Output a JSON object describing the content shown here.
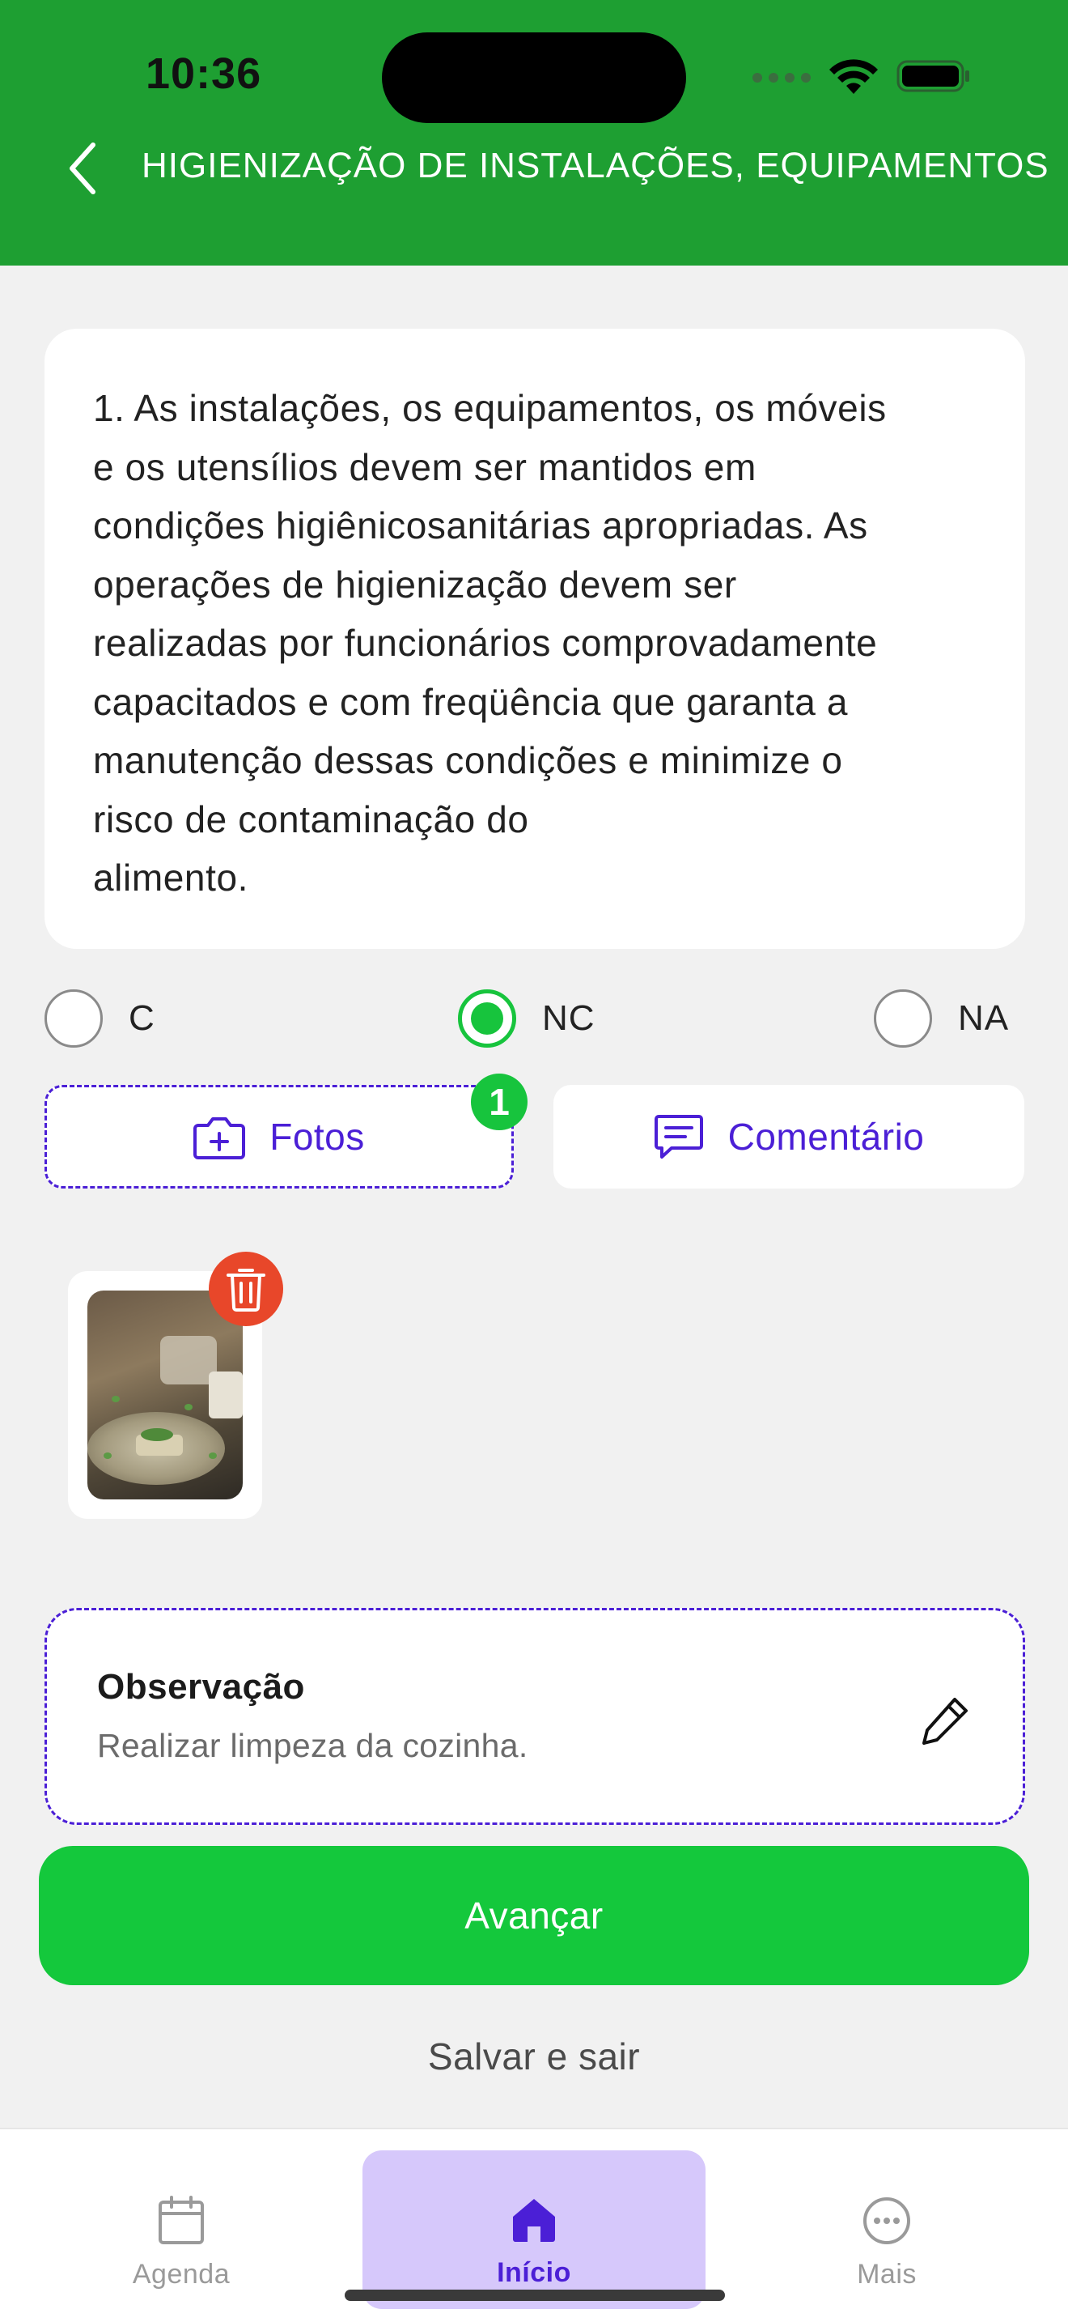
{
  "status_bar": {
    "time": "10:36"
  },
  "header": {
    "title": "HIGIENIZAÇÃO DE INSTALAÇÕES, EQUIPAMENTOS"
  },
  "question": {
    "text": "1. As instalações, os equipamentos, os móveis\ne os utensílios devem ser mantidos em\ncondições higiênicosanitárias apropriadas. As\noperações de higienização devem ser\nrealizadas por funcionários comprovadamente\ncapacitados e com freqüência que garanta a\nmanutenção dessas condições e minimize o\nrisco de contaminação do\nalimento."
  },
  "options": [
    {
      "label": "C",
      "selected": false
    },
    {
      "label": "NC",
      "selected": true
    },
    {
      "label": "NA",
      "selected": false
    }
  ],
  "actions": {
    "photos_label": "Fotos",
    "photos_count": "1",
    "comment_label": "Comentário"
  },
  "observation": {
    "title": "Observação",
    "text": "Realizar limpeza da cozinha."
  },
  "buttons": {
    "advance": "Avançar",
    "save_exit": "Salvar e sair"
  },
  "bottom_nav": {
    "items": [
      {
        "label": "Agenda",
        "icon": "calendar-icon",
        "active": false
      },
      {
        "label": "Início",
        "icon": "home-icon",
        "active": true
      },
      {
        "label": "Mais",
        "icon": "more-icon",
        "active": false
      }
    ]
  },
  "colors": {
    "header": "#1e9f32",
    "accent_green": "#14c83c",
    "accent_purple": "#4b1fd6",
    "delete_red": "#e8472a",
    "nav_active_bg": "#d6c8fb"
  }
}
